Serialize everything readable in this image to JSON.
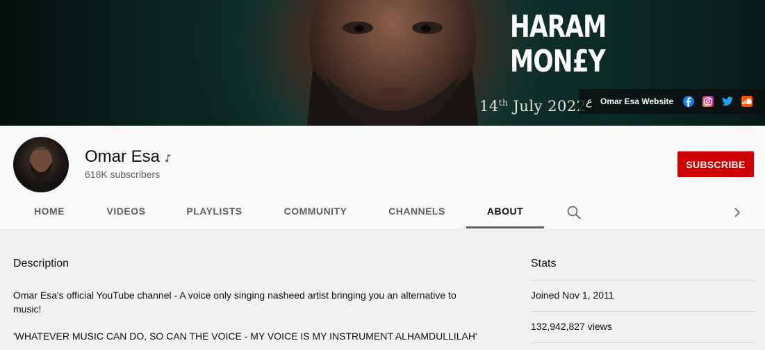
{
  "banner": {
    "title_line1": "HARAM",
    "title_line2": "MON£Y",
    "date_day": "14",
    "date_suffix": "th",
    "date_rest": " July 2022",
    "website_icon_glyph": "ع",
    "website_label": "Omar Esa Website",
    "social_icons": [
      "facebook-icon",
      "instagram-icon",
      "twitter-icon",
      "soundcloud-icon"
    ]
  },
  "channel": {
    "name": "Omar Esa",
    "subscribers": "618K subscribers",
    "subscribe_label": "SUBSCRIBE"
  },
  "tabs": [
    {
      "label": "HOME"
    },
    {
      "label": "VIDEOS"
    },
    {
      "label": "PLAYLISTS"
    },
    {
      "label": "COMMUNITY"
    },
    {
      "label": "CHANNELS"
    },
    {
      "label": "ABOUT",
      "active": true
    }
  ],
  "about": {
    "description_title": "Description",
    "description_text": "Omar Esa's official YouTube channel - A voice only singing nasheed artist bringing you an alternative to music!",
    "description_quote": "'WHATEVER MUSIC CAN DO, SO CAN THE VOICE - MY VOICE IS MY INSTRUMENT ALHAMDULLILAH'",
    "stats_title": "Stats",
    "joined": "Joined Nov 1, 2011",
    "views": "132,942,827 views"
  },
  "colors": {
    "subscribe_red": "#cc0000",
    "header_bg": "#f9f9f9",
    "content_bg": "#f1f1f1",
    "tab_text": "#606060"
  }
}
